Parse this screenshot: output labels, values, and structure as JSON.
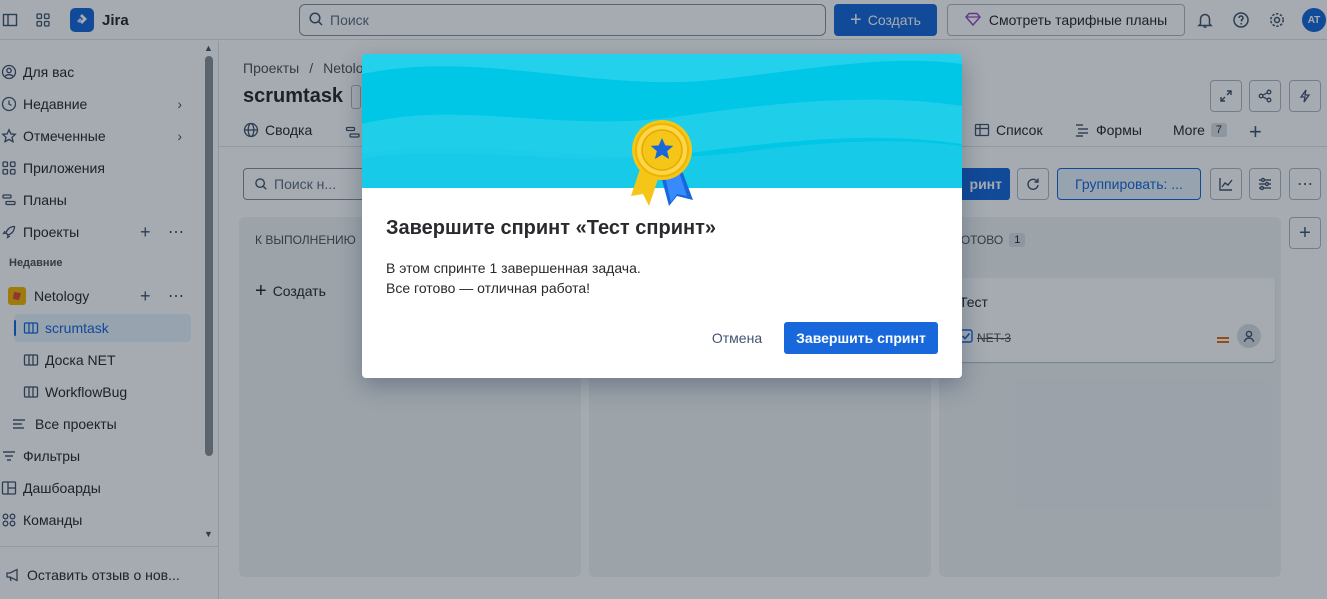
{
  "topbar": {
    "app_name": "Jira",
    "search_placeholder": "Поиск",
    "create_label": "Создать",
    "plans_label": "Смотреть тарифные планы",
    "avatar_initials": "AT"
  },
  "sidebar": {
    "items": [
      {
        "label": "Для вас"
      },
      {
        "label": "Недавние"
      },
      {
        "label": "Отмеченные"
      },
      {
        "label": "Приложения"
      },
      {
        "label": "Планы"
      },
      {
        "label": "Проекты"
      }
    ],
    "recent_section": "Недавние",
    "project": "Netology",
    "boards": [
      "scrumtask",
      "Доска NET",
      "WorkflowBug"
    ],
    "all_projects": "Все проекты",
    "filters": "Фильтры",
    "dashboards": "Дашбоарды",
    "teams": "Команды",
    "feedback": "Оставить отзыв о нов..."
  },
  "main": {
    "breadcrumb_root": "Проекты",
    "breadcrumb_project": "Netolo",
    "board_title": "scrumtask",
    "tabs": {
      "summary": "Сводка",
      "list": "Список",
      "forms": "Формы",
      "more": "More",
      "more_count": "7"
    },
    "search_placeholder": "Поиск н...",
    "complete_sprint_partial": "ринт",
    "group_by": "Группировать: ...",
    "columns": {
      "todo": "К ВЫПОЛНЕНИЮ",
      "done": "ГОТОВО",
      "done_count": "1"
    },
    "create_issue": "Создать",
    "done_card": {
      "title": "Тест",
      "key": "NET-3"
    }
  },
  "modal": {
    "title": "Завершите спринт «Тест спринт»",
    "line1": "В этом спринте 1 завершенная задача.",
    "line2": "Все готово — отличная работа!",
    "cancel": "Отмена",
    "confirm": "Завершить спринт"
  },
  "colors": {
    "brand": "#1868db",
    "hero_cyan": "#00c7e6",
    "medal_gold": "#f5c518"
  }
}
